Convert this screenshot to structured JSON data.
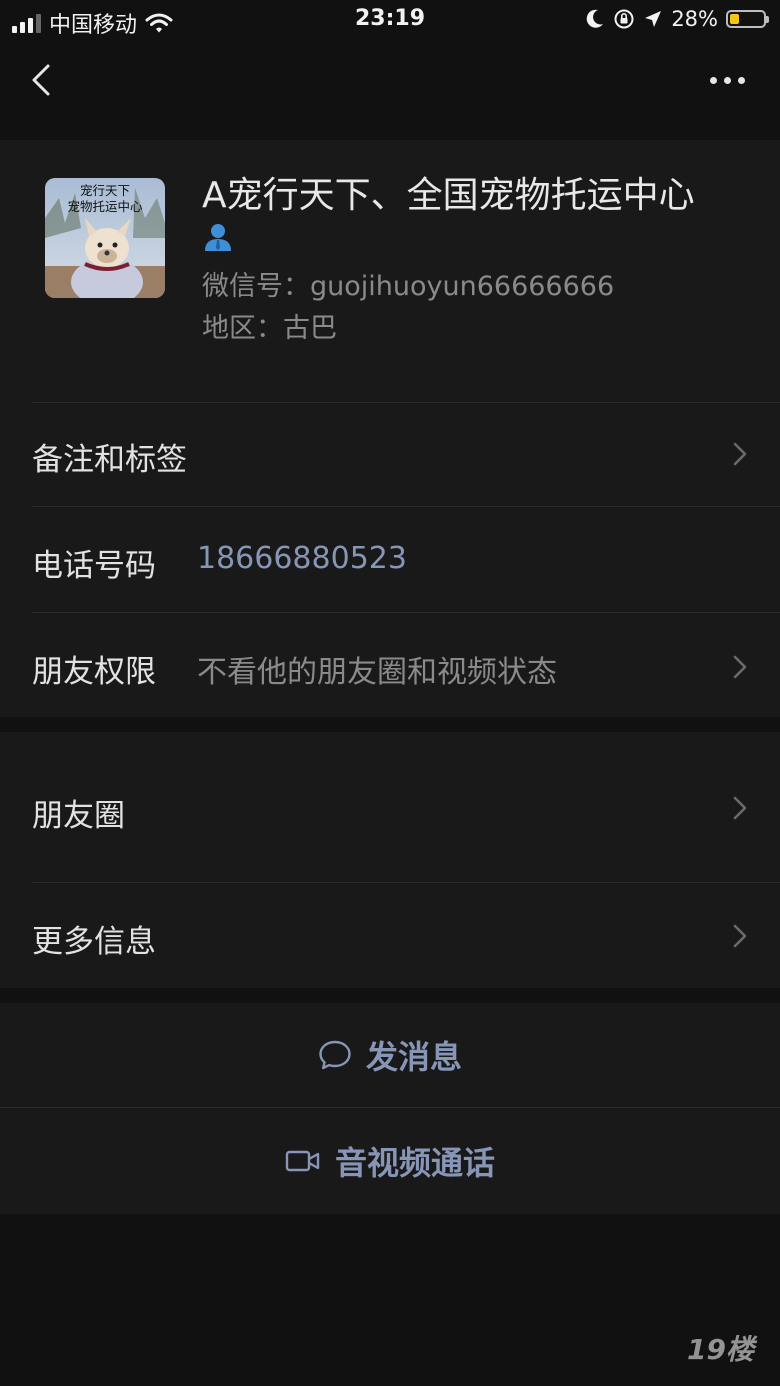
{
  "status_bar": {
    "carrier": "中国移动",
    "time": "23:19",
    "battery_percent": "28%",
    "battery_level": 0.28,
    "battery_color": "#f6c515",
    "icons": [
      "signal-icon",
      "wifi-icon",
      "moon-icon",
      "orientation-lock-icon",
      "location-arrow-icon",
      "battery-icon"
    ]
  },
  "navbar": {
    "icons": [
      "back-icon",
      "more-icon"
    ]
  },
  "profile": {
    "name": "A宠行天下、全国宠物托运中心",
    "avatar_text_line1": "宠行天下",
    "avatar_text_line2": "宠物托运中心",
    "wechat_id": "微信号：guojihuoyun66666666",
    "region": "地区：古巴",
    "badge_icon": "person-icon"
  },
  "rows": {
    "notes": {
      "label": "备注和标签"
    },
    "phone": {
      "label": "电话号码",
      "value": "18666880523"
    },
    "permission": {
      "label": "朋友权限",
      "value": "不看他的朋友圈和视频状态"
    },
    "moments": {
      "label": "朋友圈"
    },
    "more_info": {
      "label": "更多信息"
    }
  },
  "actions": {
    "message": {
      "label": "发消息",
      "icon": "chat-bubble-icon"
    },
    "call": {
      "label": "音视频通话",
      "icon": "video-camera-icon"
    }
  },
  "watermark": "19楼",
  "colors": {
    "background": "#111111",
    "panel": "#191919",
    "link": "#8795b6",
    "secondary_text": "#8a8a8a"
  }
}
